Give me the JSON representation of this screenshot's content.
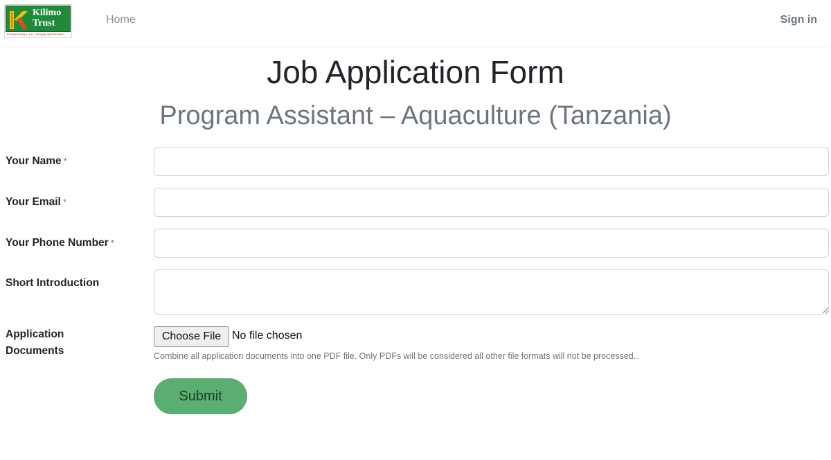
{
  "navbar": {
    "logo": {
      "name": "Kilimo Trust",
      "tagline": "Transforming Lives Through Agribusiness",
      "brand_color": "#1f8a3a"
    },
    "home_label": "Home",
    "signin_label": "Sign in"
  },
  "page": {
    "title": "Job Application Form",
    "subtitle": "Program Assistant – Aquaculture (Tanzania)"
  },
  "form": {
    "required_marker": "*",
    "fields": {
      "name": {
        "label": "Your Name",
        "value": ""
      },
      "email": {
        "label": "Your Email",
        "value": ""
      },
      "phone": {
        "label": "Your Phone Number",
        "value": ""
      },
      "intro": {
        "label": "Short Introduction",
        "value": ""
      }
    },
    "documents": {
      "label_line1": "Application",
      "label_line2": "Documents",
      "choose_label": "Choose File",
      "status": "No file chosen",
      "help": "Combine all application documents into one PDF file. Only PDFs will be considered all other file formats will not be processed.."
    },
    "submit_label": "Submit",
    "submit_color": "#5aae71"
  }
}
